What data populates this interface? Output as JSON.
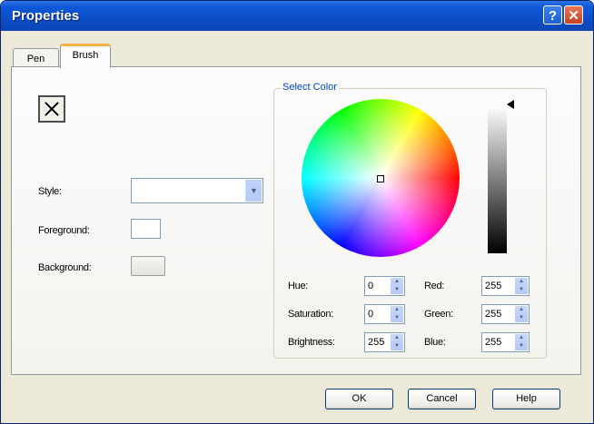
{
  "window": {
    "title": "Properties",
    "help_glyph": "?",
    "close_glyph": "✕"
  },
  "tabs": [
    {
      "label": "Pen"
    },
    {
      "label": "Brush"
    }
  ],
  "brush": {
    "preview_icon": "x-box-icon",
    "style_label": "Style:",
    "style_value": "",
    "foreground_label": "Foreground:",
    "background_label": "Background:"
  },
  "color_picker": {
    "group_label": "Select Color",
    "fields": {
      "hue": {
        "label": "Hue:",
        "value": "0"
      },
      "saturation": {
        "label": "Saturation:",
        "value": "0"
      },
      "brightness": {
        "label": "Brightness:",
        "value": "255"
      },
      "red": {
        "label": "Red:",
        "value": "255"
      },
      "green": {
        "label": "Green:",
        "value": "255"
      },
      "blue": {
        "label": "Blue:",
        "value": "255"
      }
    }
  },
  "buttons": {
    "ok": "OK",
    "cancel": "Cancel",
    "help": "Help"
  },
  "colors": {
    "title_bar": "#0b4ec6",
    "group_title": "#0046d5",
    "tab_highlight": "#f5b142"
  }
}
